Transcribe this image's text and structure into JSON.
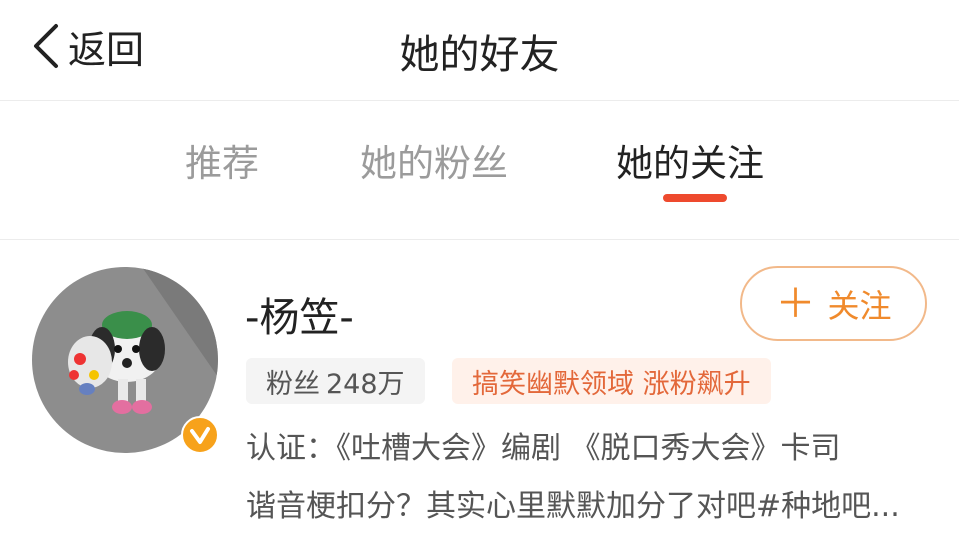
{
  "header": {
    "back_label": "返回",
    "title": "她的好友"
  },
  "tabs": [
    {
      "label": "推荐",
      "active": false
    },
    {
      "label": "她的粉丝",
      "active": false
    },
    {
      "label": "她的关注",
      "active": true
    }
  ],
  "user": {
    "name": "-杨笠-",
    "follow_label": "关注",
    "fans_label": "粉丝",
    "fans_count": "248万",
    "hot_badge": "搞笑幽默领域 涨粉飙升",
    "verify_line": "认证：《吐槽大会》编剧 《脱口秀大会》卡司",
    "intro_line": "谐音梗扣分？其实心里默默加分了对吧#种地吧..."
  },
  "colors": {
    "accent_orange": "#f08a2c",
    "tab_indicator": "#ee4a2e",
    "verify_badge": "#f7a21b"
  },
  "icons": [
    "chevron-left-icon",
    "plus-icon",
    "verified-icon"
  ]
}
